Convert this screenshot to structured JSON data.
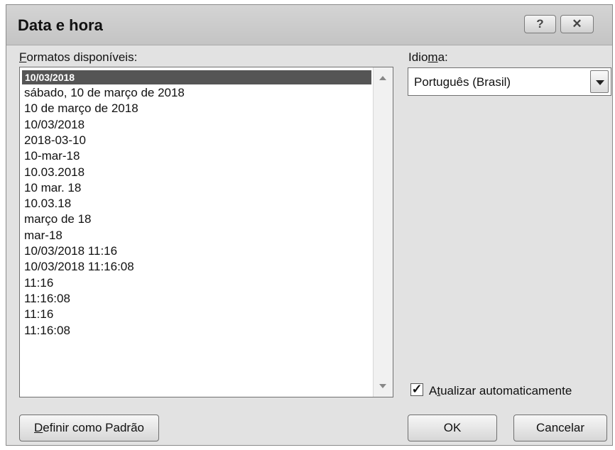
{
  "dialog": {
    "title": "Data e hora",
    "help_label": "?",
    "close_label": "✕"
  },
  "formats": {
    "label_accel": "F",
    "label_rest": "ormatos disponíveis:",
    "items": [
      "10/03/2018",
      "sábado, 10 de março de 2018",
      "10 de março de 2018",
      "10/03/2018",
      "2018-03-10",
      "10-mar-18",
      "10.03.2018",
      "10 mar. 18",
      "10.03.18",
      "março de 18",
      "mar-18",
      "10/03/2018 11:16",
      "10/03/2018 11:16:08",
      "11:16",
      "11:16:08",
      "11:16",
      "11:16:08"
    ],
    "selected_index": 0
  },
  "language": {
    "label_pre": "Idio",
    "label_accel": "m",
    "label_post": "a:",
    "value": "Português (Brasil)"
  },
  "auto_update": {
    "checked": true,
    "check_mark": "✓",
    "label_pre": "A",
    "label_accel": "t",
    "label_post": "ualizar automaticamente"
  },
  "buttons": {
    "default_accel": "D",
    "default_rest": "efinir como Padrão",
    "ok": "OK",
    "cancel": "Cancelar"
  }
}
